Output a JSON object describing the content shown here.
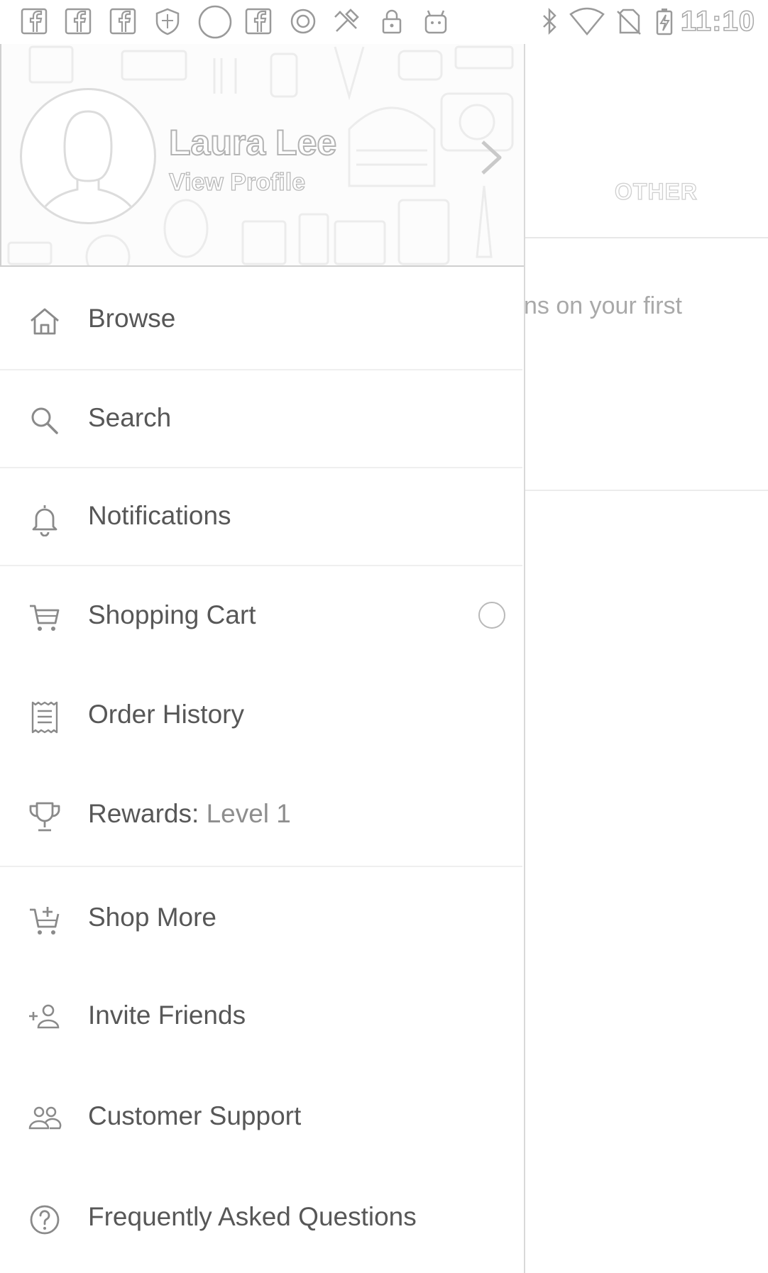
{
  "status_bar": {
    "time": "11:10",
    "left_icons": [
      "facebook-icon",
      "facebook-icon",
      "facebook-icon",
      "shield-icon",
      "circle-icon",
      "facebook-icon",
      "record-icon",
      "tools-icon",
      "lock-icon",
      "android-icon"
    ],
    "right_icons": [
      "bluetooth-icon",
      "wifi-icon",
      "no-sim-icon",
      "battery-charging-icon"
    ]
  },
  "background_app": {
    "tab_other": "OTHER",
    "promo_fragment": "ns on your first"
  },
  "drawer": {
    "profile": {
      "name": "Laura Lee",
      "link": "View Profile"
    },
    "items": [
      {
        "icon": "home-icon",
        "label": "Browse"
      },
      {
        "icon": "search-icon",
        "label": "Search"
      },
      {
        "icon": "bell-icon",
        "label": "Notifications"
      },
      {
        "icon": "cart-icon",
        "label": "Shopping Cart"
      },
      {
        "icon": "receipt-icon",
        "label": "Order History"
      },
      {
        "icon": "trophy-icon",
        "label": "Rewards: ",
        "sublabel": "Level 1"
      },
      {
        "icon": "add-cart-icon",
        "label": "Shop More"
      },
      {
        "icon": "add-person-icon",
        "label": "Invite Friends"
      },
      {
        "icon": "people-icon",
        "label": "Customer Support"
      },
      {
        "icon": "help-icon",
        "label": "Frequently Asked Questions"
      }
    ]
  },
  "colors": {
    "text": "#575757",
    "icon": "#8a8a8a",
    "divider": "#efefef"
  }
}
